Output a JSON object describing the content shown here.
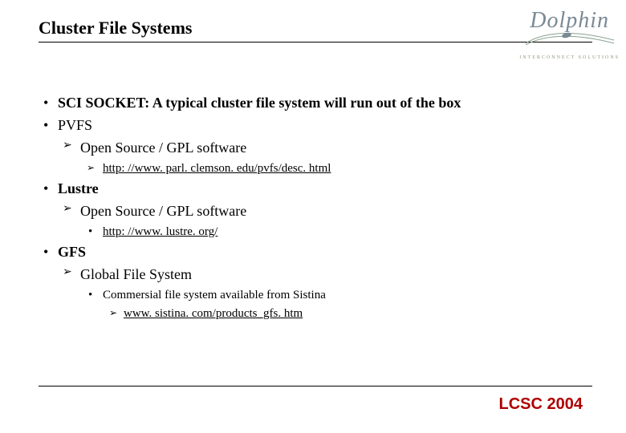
{
  "header": {
    "title": "Cluster File Systems",
    "logo_name": "Dolphin",
    "logo_tagline": "INTERCONNECT SOLUTIONS"
  },
  "bullets": {
    "sci_socket": "SCI SOCKET: A typical cluster file system will run out of the box",
    "pvfs": {
      "label": "PVFS",
      "open_source": "Open Source / GPL software",
      "link": "http: //www. parl. clemson. edu/pvfs/desc. html"
    },
    "lustre": {
      "label": "Lustre",
      "open_source": "Open Source / GPL software",
      "link": "http: //www. lustre. org/"
    },
    "gfs": {
      "label": "GFS",
      "desc": "Global File System",
      "commercial": "Commersial file system available from Sistina",
      "link": "www. sistina. com/products_gfs. htm"
    }
  },
  "footer": {
    "event": "LCSC 2004"
  }
}
